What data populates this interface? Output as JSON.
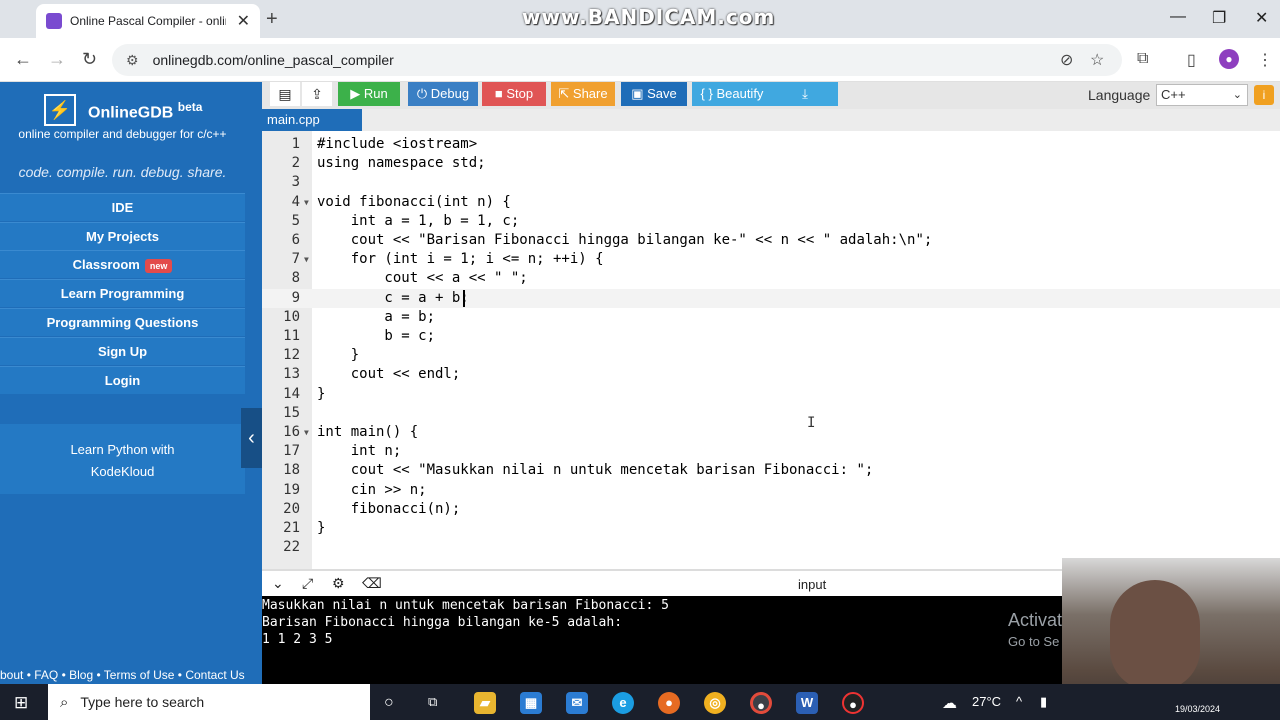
{
  "browser": {
    "tab_title": "Online Pascal Compiler - online",
    "watermark": "www.BANDICAM.com",
    "url": "onlinegdb.com/online_pascal_compiler"
  },
  "sidebar": {
    "brand": "OnlineGDB",
    "brand_sup": "beta",
    "tagline": "online compiler and debugger for c/c++",
    "slogan": "code. compile. run. debug. share.",
    "items": [
      {
        "label": "IDE"
      },
      {
        "label": "My Projects"
      },
      {
        "label": "Classroom",
        "badge": "new"
      },
      {
        "label": "Learn Programming"
      },
      {
        "label": "Programming Questions"
      },
      {
        "label": "Sign Up"
      },
      {
        "label": "Login"
      }
    ],
    "promo_line1": "Learn Python with",
    "promo_line2": "KodeKloud",
    "footer": "bout • FAQ • Blog • Terms of Use • Contact Us"
  },
  "toolbar": {
    "run": "Run",
    "debug": "Debug",
    "stop": "Stop",
    "share": "Share",
    "save": "Save",
    "beautify": "{ } Beautify",
    "language_label": "Language",
    "language_value": "C++",
    "colors": {
      "run": "#3cb14a",
      "debug": "#3a7fc4",
      "stop": "#e05555",
      "share": "#f0a030",
      "save": "#1f6db8",
      "beautify": "#40a8e0",
      "download": "#40a8e0"
    }
  },
  "file_tab": "main.cpp",
  "editor": {
    "lines": [
      "#include <iostream>",
      "using namespace std;",
      "",
      "void fibonacci(int n) {",
      "    int a = 1, b = 1, c;",
      "    cout << \"Barisan Fibonacci hingga bilangan ke-\" << n << \" adalah:\\n\";",
      "    for (int i = 1; i <= n; ++i) {",
      "        cout << a << \" \";",
      "        c = a + b;",
      "        a = b;",
      "        b = c;",
      "    }",
      "    cout << endl;",
      "}",
      "",
      "int main() {",
      "    int n;",
      "    cout << \"Masukkan nilai n untuk mencetak barisan Fibonacci: \";",
      "    cin >> n;",
      "    fibonacci(n);",
      "}",
      ""
    ],
    "active_line": 9
  },
  "output": {
    "label": "input",
    "console_lines": [
      "Masukkan nilai n untuk mencetak barisan Fibonacci: 5",
      "Barisan Fibonacci hingga bilangan ke-5 adalah:",
      "1 1 2 3 5"
    ],
    "activate_title": "Activate W",
    "activate_sub": "Go to Se               dows."
  },
  "taskbar": {
    "search_placeholder": "Type here to search",
    "temperature": "27°C",
    "date": "19/03/2024"
  }
}
